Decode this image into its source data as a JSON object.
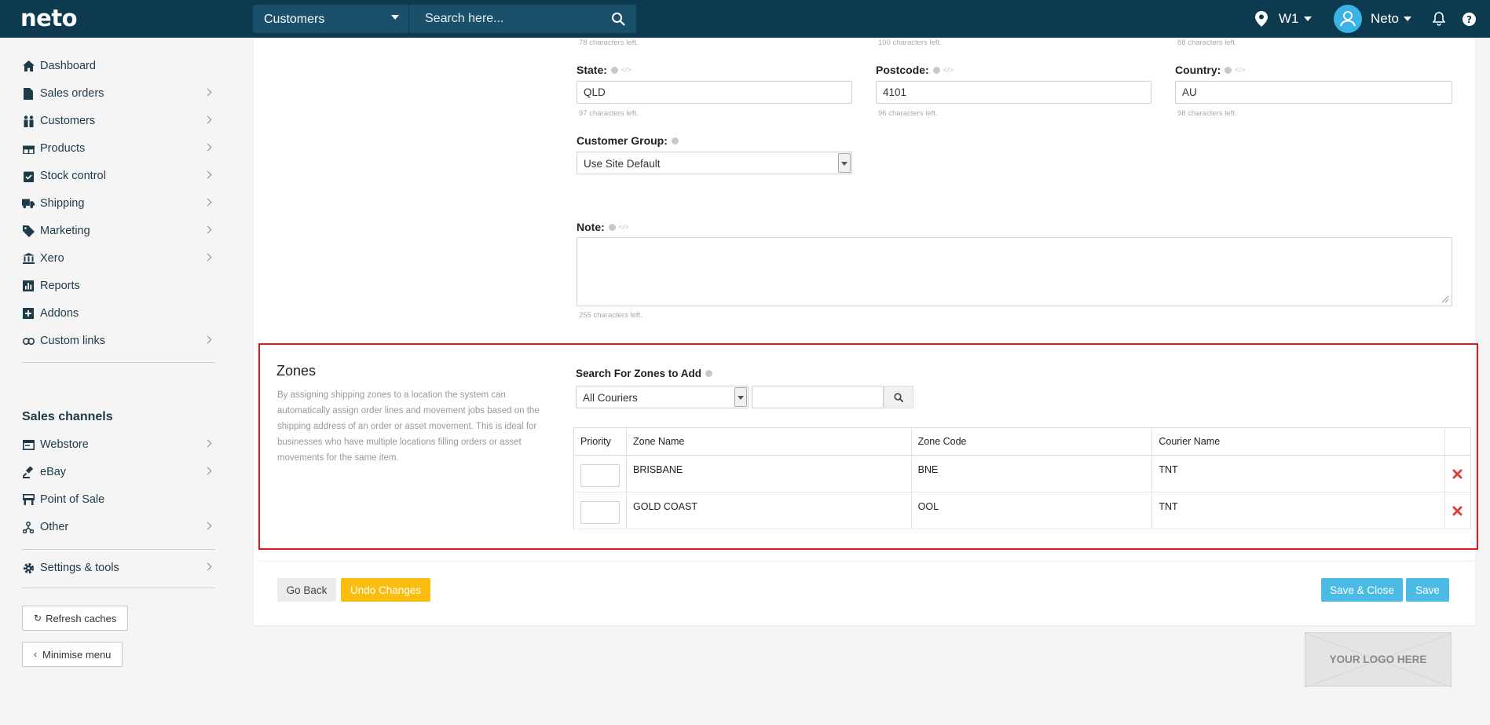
{
  "topbar": {
    "logo": "neto",
    "context_select": "Customers",
    "search_placeholder": "Search here...",
    "location": "W1",
    "user": "Neto"
  },
  "sidebar": {
    "items": [
      {
        "label": "Dashboard",
        "icon": "home-icon"
      },
      {
        "label": "Sales orders",
        "icon": "file-icon"
      },
      {
        "label": "Customers",
        "icon": "users-icon"
      },
      {
        "label": "Products",
        "icon": "gift-icon"
      },
      {
        "label": "Stock control",
        "icon": "clipboard-check-icon"
      },
      {
        "label": "Shipping",
        "icon": "truck-icon"
      },
      {
        "label": "Marketing",
        "icon": "tag-icon"
      },
      {
        "label": "Xero",
        "icon": "bank-icon"
      },
      {
        "label": "Reports",
        "icon": "chart-icon"
      },
      {
        "label": "Addons",
        "icon": "plus-square-icon"
      },
      {
        "label": "Custom links",
        "icon": "link-icon"
      }
    ],
    "channels_heading": "Sales channels",
    "channels": [
      {
        "label": "Webstore",
        "icon": "browser-icon"
      },
      {
        "label": "eBay",
        "icon": "gavel-icon"
      },
      {
        "label": "Point of Sale",
        "icon": "register-icon"
      },
      {
        "label": "Other",
        "icon": "share-icon"
      }
    ],
    "settings": "Settings & tools",
    "refresh_caches": "Refresh caches",
    "minimise_menu": "Minimise menu"
  },
  "form": {
    "top_chars_left": [
      "78 characters left.",
      "100 characters left.",
      "88 characters left."
    ],
    "state": {
      "label": "State:",
      "value": "QLD",
      "chars_left": "97 characters left."
    },
    "postcode": {
      "label": "Postcode:",
      "value": "4101",
      "chars_left": "96 characters left."
    },
    "country": {
      "label": "Country:",
      "value": "AU",
      "chars_left": "98 characters left."
    },
    "customer_group": {
      "label": "Customer Group:",
      "value": "Use Site Default"
    },
    "note": {
      "label": "Note:",
      "chars_left": "255 characters left."
    },
    "code_glyph": "</>"
  },
  "zones": {
    "title": "Zones",
    "description": "By assigning shipping zones to a location the system can automatically assign order lines and movement jobs based on the shipping address of an order or asset movement. This is ideal for businesses who have multiple locations filling orders or asset movements for the same item.",
    "search_label": "Search For Zones to Add",
    "courier_select": "All Couriers",
    "columns": [
      "Priority",
      "Zone Name",
      "Zone Code",
      "Courier Name"
    ],
    "rows": [
      {
        "zone_name": "BRISBANE",
        "zone_code": "BNE",
        "courier_name": "TNT"
      },
      {
        "zone_name": "GOLD COAST",
        "zone_code": "OOL",
        "courier_name": "TNT"
      }
    ]
  },
  "actions": {
    "go_back": "Go Back",
    "undo": "Undo Changes",
    "save_close": "Save & Close",
    "save": "Save"
  },
  "logo_placeholder": "YOUR LOGO HERE",
  "colors": {
    "topbar": "#0d3a4f",
    "accent_blue": "#4bbbe6",
    "undo_yellow": "#fcbd11",
    "highlight_red": "#e8151b"
  }
}
